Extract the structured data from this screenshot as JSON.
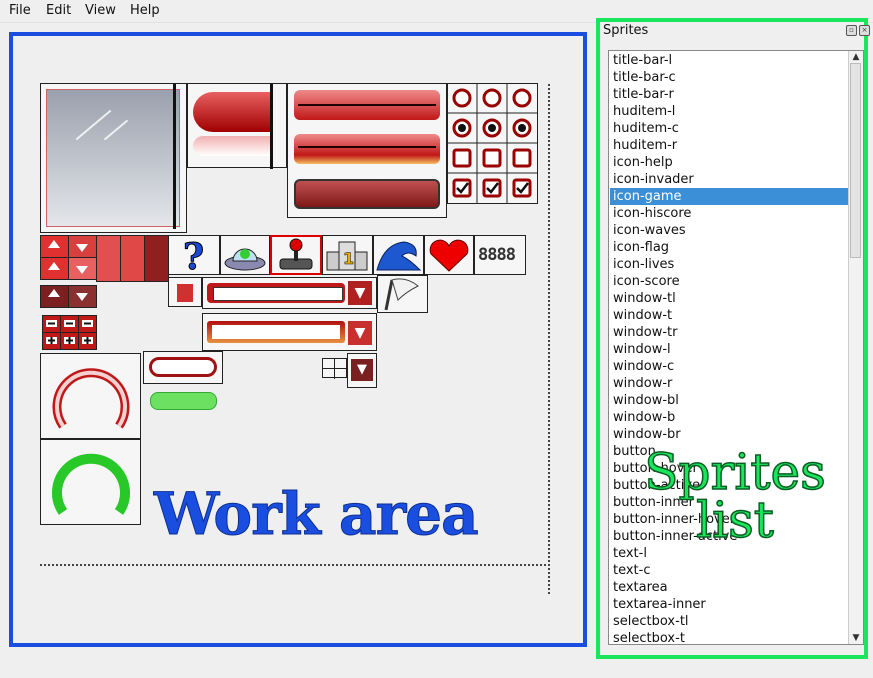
{
  "menu": [
    "File",
    "Edit",
    "View",
    "Help"
  ],
  "work_area": {
    "label": "Work area",
    "color": "#1a4ee0"
  },
  "sprites_panel": {
    "title": "Sprites",
    "label": "Sprites list",
    "color": "#19e65c",
    "selected": "icon-game",
    "items": [
      "title-bar-l",
      "title-bar-c",
      "title-bar-r",
      "huditem-l",
      "huditem-c",
      "huditem-r",
      "icon-help",
      "icon-invader",
      "icon-game",
      "icon-hiscore",
      "icon-waves",
      "icon-flag",
      "icon-lives",
      "icon-score",
      "window-tl",
      "window-t",
      "window-tr",
      "window-l",
      "window-c",
      "window-r",
      "window-bl",
      "window-b",
      "window-br",
      "button",
      "button-hover",
      "button-active",
      "button-inner",
      "button-inner-hover",
      "button-inner-active",
      "text-l",
      "text-c",
      "textarea",
      "textarea-inner",
      "selectbox-tl",
      "selectbox-t"
    ]
  },
  "icons": {
    "help": "question-mark-icon",
    "invader": "ufo-alien-icon",
    "game": "joystick-icon",
    "hiscore": "podium-trophy-icon",
    "waves": "wave-icon",
    "lives": "heart-icon",
    "score": "digital-counter-icon",
    "flag": "white-flag-icon"
  }
}
